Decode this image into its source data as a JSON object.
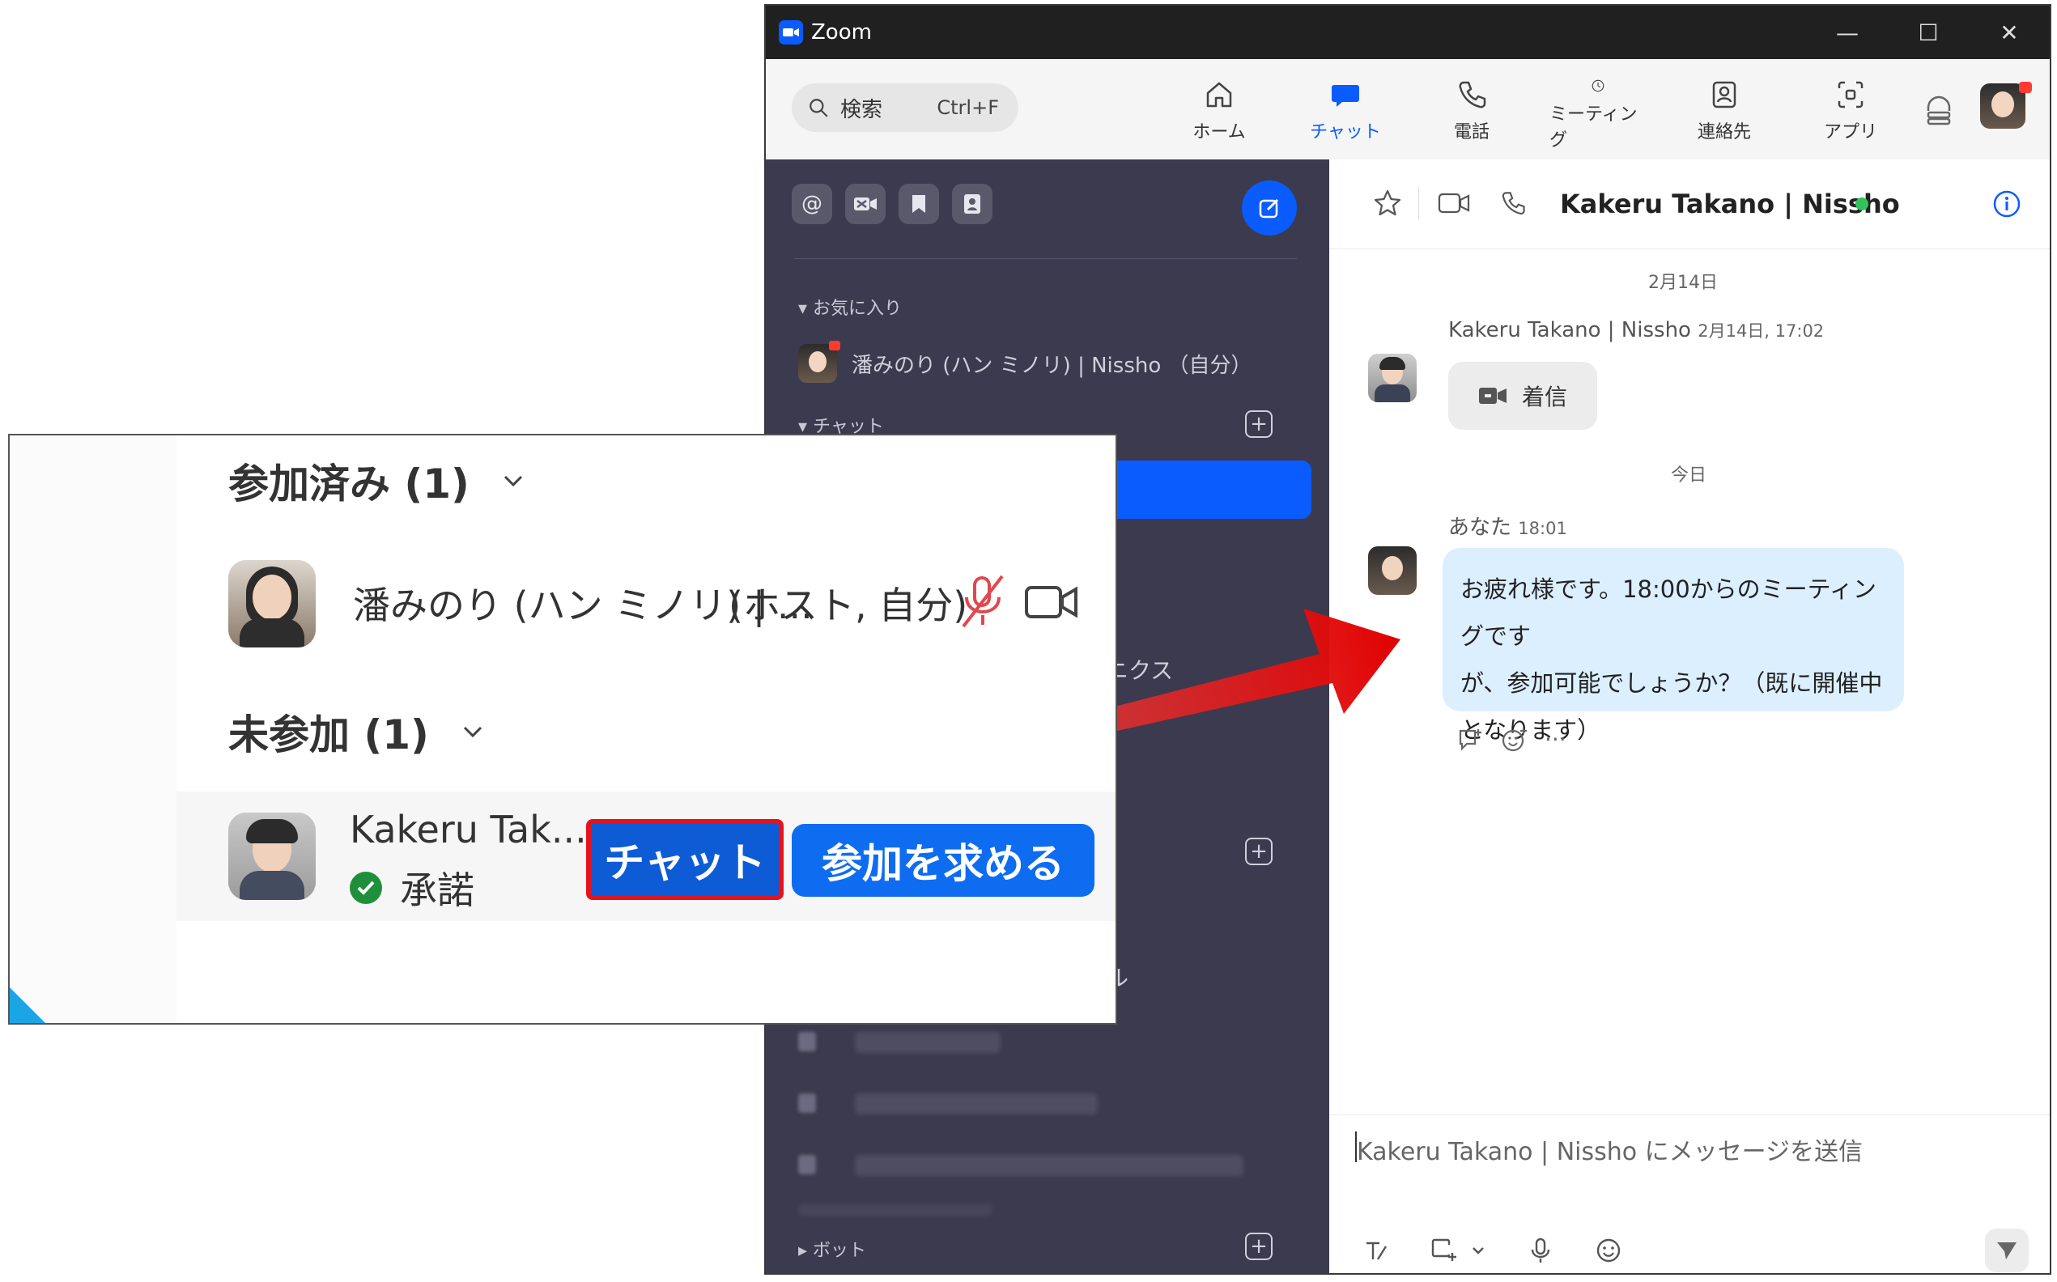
{
  "window": {
    "title": "Zoom",
    "controls": [
      "—",
      "☐",
      "✕"
    ]
  },
  "toolbar": {
    "search_label": "検索",
    "search_shortcut": "Ctrl+F",
    "tabs": [
      {
        "label": "ホーム",
        "icon": "home-icon"
      },
      {
        "label": "チャット",
        "icon": "chat-icon",
        "active": true
      },
      {
        "label": "電話",
        "icon": "phone-icon"
      },
      {
        "label": "ミーティング",
        "icon": "clock-icon"
      },
      {
        "label": "連絡先",
        "icon": "contacts-icon"
      },
      {
        "label": "アプリ",
        "icon": "apps-icon"
      }
    ]
  },
  "sidebar": {
    "sections": {
      "favorites": "お気に入り",
      "chat": "チャット",
      "bots": "ボット"
    },
    "favorite_item": "潘みのり (ハン ミノリ) | Nissho （自分）",
    "partial_texts": [
      "ニクス",
      "ル"
    ]
  },
  "chat": {
    "title": "Kakeru Takano | Nissho",
    "date1": "2月14日",
    "msg1_sender": "Kakeru Takano | Nissho",
    "msg1_time": "2月14日, 17:02",
    "msg1_call": "着信",
    "date2": "今日",
    "msg2_sender": "あなた",
    "msg2_time": "18:01",
    "msg2_lines": [
      "お疲れ様です。18:00からのミーティングです",
      "が、参加可能でしょうか？（既に開催中",
      "となります）"
    ],
    "reactions_more": "···",
    "input_placeholder": "Kakeru Takano | Nissho にメッセージを送信"
  },
  "popup": {
    "joined_heading": "参加済み (1)",
    "joined_name": "潘みのり (ハン ミノリ) | ...",
    "joined_role": "(ホスト, 自分)",
    "not_joined_heading": "未参加 (1)",
    "not_joined_name": "Kakeru Tak...",
    "status": "承諾",
    "chat_button": "チャット",
    "ask_join_button": "参加を求める"
  },
  "colors": {
    "accent": "#0b5cff",
    "highlight": "#e8121d",
    "sidebar_bg": "#3b3a4e",
    "bubble": "#dcefff",
    "online": "#2fc35a"
  }
}
